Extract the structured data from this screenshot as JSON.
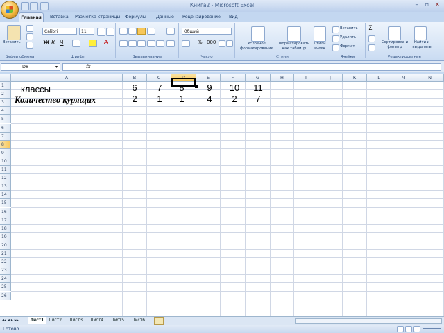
{
  "window": {
    "title": "Книга2 - Microsoft Excel"
  },
  "ribbon_tabs": [
    "Главная",
    "Вставка",
    "Разметка страницы",
    "Формулы",
    "Данные",
    "Рецензирование",
    "Вид"
  ],
  "ribbon": {
    "paste_label": "Вставить",
    "font_name": "Calibri",
    "font_size": "11",
    "number_format": "Общий",
    "conditional_formatting": "Условное форматирование",
    "format_as_table": "Форматировать как таблицу",
    "cell_styles": "Стили ячеек",
    "insert": "Вставить",
    "delete": "Удалить",
    "format": "Формат",
    "sort_filter": "Сортировка и фильтр",
    "find_select": "Найти и выделить",
    "groups": [
      "Буфер обмена",
      "Шрифт",
      "Выравнивание",
      "Число",
      "Стили",
      "Ячейки",
      "Редактирование"
    ]
  },
  "formula_bar": {
    "name_box": "D8",
    "fx": "fx",
    "value": ""
  },
  "columns": [
    "A",
    "B",
    "C",
    "D",
    "E",
    "F",
    "G",
    "H",
    "I",
    "J",
    "K",
    "L",
    "M",
    "N"
  ],
  "selected_column": "D",
  "rows": [
    "1",
    "2",
    "3",
    "4",
    "5",
    "6",
    "7",
    "8",
    "9",
    "10",
    "11",
    "12",
    "13",
    "14",
    "15",
    "16",
    "17",
    "18",
    "19",
    "20",
    "21",
    "22",
    "23",
    "24",
    "25",
    "26"
  ],
  "selected_row": "8",
  "cells": {
    "A1": "классы",
    "A2": "Количество курящих",
    "row1": [
      "6",
      "7",
      "8",
      "9",
      "10",
      "11"
    ],
    "row2": [
      "2",
      "1",
      "1",
      "4",
      "2",
      "7"
    ]
  },
  "sheets": [
    "Лист1",
    "Лист2",
    "Лист3",
    "Лист4",
    "Лист5",
    "Лист6"
  ],
  "status": {
    "ready": "Готово"
  }
}
